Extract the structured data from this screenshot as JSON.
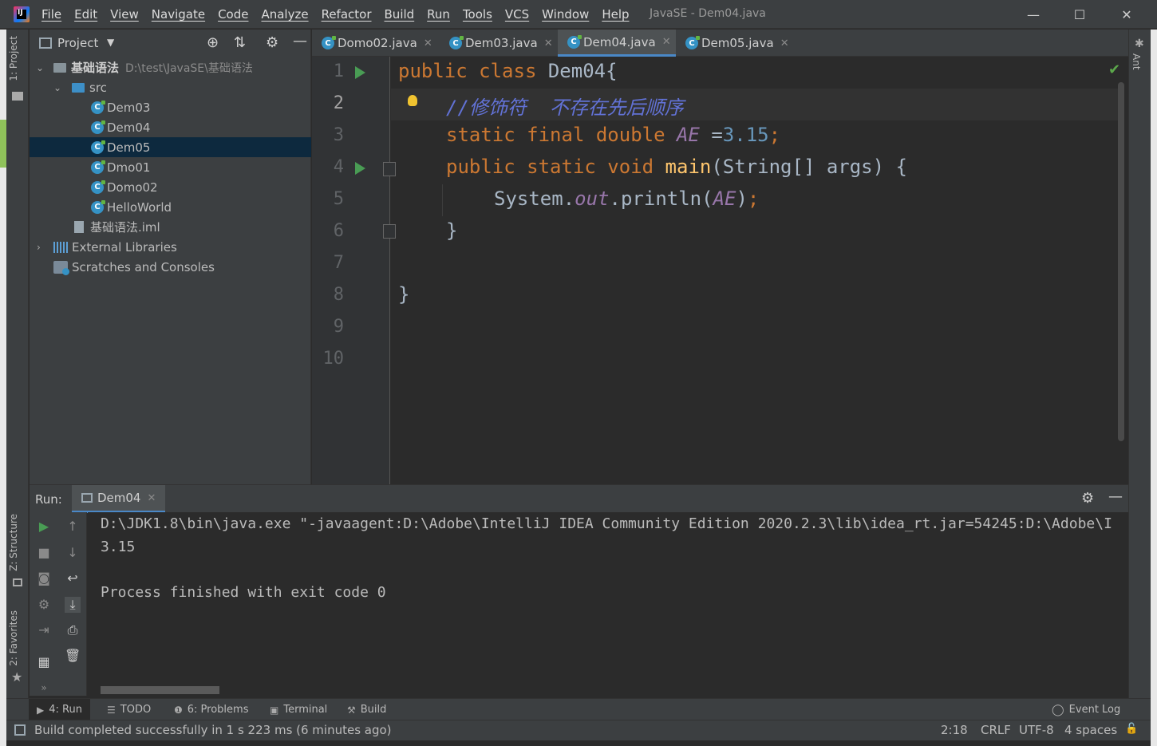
{
  "titlebar": {
    "menu": [
      "File",
      "Edit",
      "View",
      "Navigate",
      "Code",
      "Analyze",
      "Refactor",
      "Build",
      "Run",
      "Tools",
      "VCS",
      "Window",
      "Help"
    ],
    "window_title": "JavaSE - Dem04.java",
    "minimize": "—",
    "maximize": "☐",
    "close": "✕"
  },
  "left_strip": {
    "project_tab": "1: Project",
    "structure_tab": "Z: Structure",
    "favorites_tab": "2: Favorites"
  },
  "right_strip": {
    "ant_tab": "Ant"
  },
  "project": {
    "title": "Project",
    "tree": [
      {
        "label": "基础语法",
        "path": "D:\\test\\JavaSE\\基础语法",
        "type": "module"
      },
      {
        "label": "src",
        "type": "folder"
      },
      {
        "label": "Dem03",
        "type": "class"
      },
      {
        "label": "Dem04",
        "type": "class"
      },
      {
        "label": "Dem05",
        "type": "class",
        "selected": true
      },
      {
        "label": "Dmo01",
        "type": "class"
      },
      {
        "label": "Domo02",
        "type": "class"
      },
      {
        "label": "HelloWorld",
        "type": "class"
      },
      {
        "label": "基础语法.iml",
        "type": "file"
      },
      {
        "label": "External Libraries",
        "type": "library"
      },
      {
        "label": "Scratches and Consoles",
        "type": "scratch"
      }
    ]
  },
  "editor_tabs": [
    {
      "label": "Domo02.java",
      "active": false
    },
    {
      "label": "Dem03.java",
      "active": false
    },
    {
      "label": "Dem04.java",
      "active": true
    },
    {
      "label": "Dem05.java",
      "active": false
    }
  ],
  "editor": {
    "line_numbers": [
      "1",
      "2",
      "3",
      "4",
      "5",
      "6",
      "7",
      "8",
      "9",
      "10"
    ],
    "code": {
      "l1_kw": "public class ",
      "l1_name": "Dem04{",
      "l2_comment": "//修饰符  不存在先后顺序",
      "l3_kw": "static final double ",
      "l3_field": "AE",
      "l3_eq": " =",
      "l3_num": "3.15",
      "l3_semi": ";",
      "l4_kw": "public static void ",
      "l4_fn": "main",
      "l4_rest": "(String[] args) {",
      "l5_a": "System.",
      "l5_out": "out",
      "l5_b": ".println(",
      "l5_field": "AE",
      "l5_c": ")",
      "l5_semi": ";",
      "l6": "}",
      "l8": "}"
    }
  },
  "run_panel": {
    "label": "Run:",
    "tab": "Dem04",
    "output": [
      "D:\\JDK1.8\\bin\\java.exe \"-javaagent:D:\\Adobe\\IntelliJ IDEA Community Edition 2020.2.3\\lib\\idea_rt.jar=54245:D:\\Adobe\\I",
      "3.15",
      "",
      "Process finished with exit code 0"
    ]
  },
  "bottom_tabs": [
    {
      "icon": "▶",
      "label": "4: Run",
      "active": true
    },
    {
      "icon": "☰",
      "label": "TODO",
      "active": false
    },
    {
      "icon": "❶",
      "label": "6: Problems",
      "active": false
    },
    {
      "icon": "▣",
      "label": "Terminal",
      "active": false
    },
    {
      "icon": "⚒",
      "label": "Build",
      "active": false
    }
  ],
  "event_log": "Event Log",
  "status": {
    "message": "Build completed successfully in 1 s 223 ms (6 minutes ago)",
    "position": "2:18",
    "line_sep": "CRLF",
    "encoding": "UTF-8",
    "indent": "4 spaces"
  }
}
